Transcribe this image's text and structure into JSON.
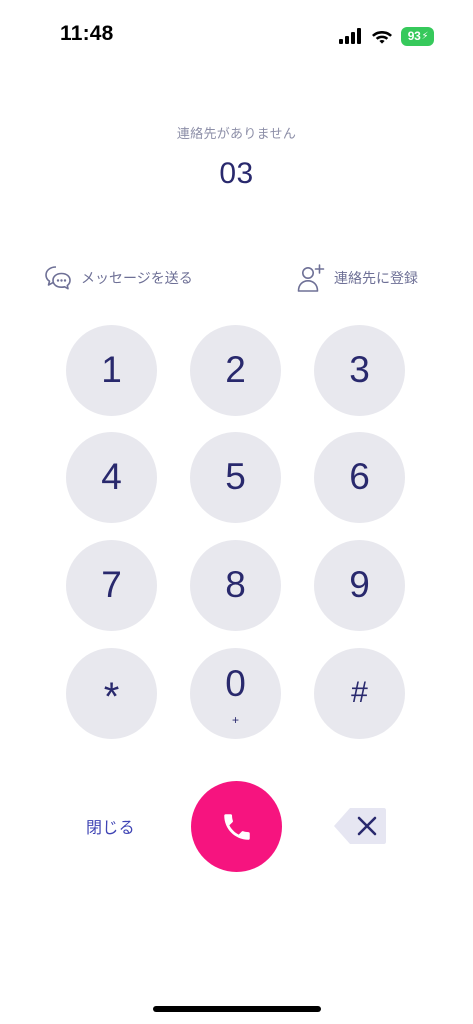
{
  "status_bar": {
    "time": "11:48",
    "battery": "93"
  },
  "dialer": {
    "no_contact_text": "連絡先がありません",
    "dialed_number": "03"
  },
  "actions": {
    "send_message": "メッセージを送る",
    "add_contact": "連絡先に登録"
  },
  "keypad": {
    "keys": [
      {
        "digit": "1"
      },
      {
        "digit": "2"
      },
      {
        "digit": "3"
      },
      {
        "digit": "4"
      },
      {
        "digit": "5"
      },
      {
        "digit": "6"
      },
      {
        "digit": "7"
      },
      {
        "digit": "8"
      },
      {
        "digit": "9"
      },
      {
        "digit": "*"
      },
      {
        "digit": "0",
        "sub": "+"
      },
      {
        "digit": "#"
      }
    ]
  },
  "bottom": {
    "close_label": "閉じる"
  },
  "colors": {
    "call_button": "#f6147f",
    "key_background": "#e8e8ee",
    "digit_text": "#29296d",
    "accent_link": "#3f44b4",
    "battery": "#36c95b"
  },
  "icons": {
    "status": [
      "signal-icon",
      "wifi-icon",
      "battery-icon"
    ],
    "actions": [
      "message-bubbles-icon",
      "add-person-icon"
    ],
    "bottom": [
      "phone-icon",
      "backspace-icon"
    ]
  }
}
